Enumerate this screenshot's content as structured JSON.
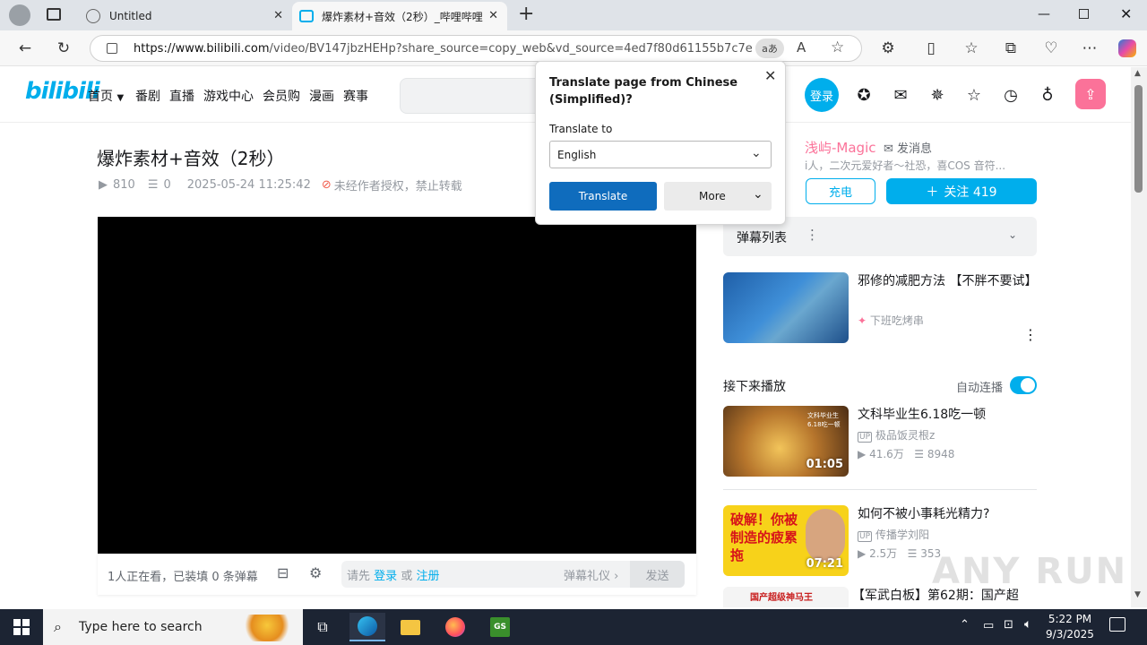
{
  "browser": {
    "tabs": [
      {
        "title": "Untitled",
        "active": false
      },
      {
        "title": "爆炸素材+音效（2秒）_哔哩哔哩",
        "active": true
      }
    ],
    "new_tab_label": "+",
    "url_host": "https://www.bilibili.com",
    "url_path": "/video/BV147jbzHEHp?share_source=copy_web&vd_source=4ed7f80d61155b7c7eee...",
    "read_aloud_label": "aあ"
  },
  "bili_header": {
    "logo": "bilibili",
    "nav": [
      "首页",
      "番剧",
      "直播",
      "游戏中心",
      "会员购",
      "漫画",
      "赛事"
    ],
    "login_label": "登录"
  },
  "video": {
    "title": "爆炸素材+音效（2秒）",
    "views": "810",
    "danmaku_count": "0",
    "date": "2025-05-24 11:25:42",
    "copyright": "未经作者授权，禁止转载",
    "watching": "1人正在看，已装填 0 条弹幕",
    "danmaku_placeholder_prefix": "请先",
    "login_link": "登录",
    "or": "或",
    "register_link": "注册",
    "etiquette": "弹幕礼仪",
    "send_label": "发送"
  },
  "uploader": {
    "name": "浅屿-Magic",
    "message_label": "发消息",
    "bio": "i人，二次元爱好者～社恐，喜COS 音符...",
    "charge_label": "充电",
    "follow_label": "关注 419"
  },
  "danmaku_list": {
    "label": "弹幕列表"
  },
  "ad": {
    "title": "邪修的减肥方法 【不胖不要试】",
    "author": "下班吃烤串"
  },
  "up_next": {
    "label": "接下来播放",
    "autoplay_label": "自动连播",
    "autoplay_on": true
  },
  "recommendations": [
    {
      "title": "文科毕业生6.18吃一顿",
      "author": "极品饭灵根z",
      "views": "41.6万",
      "danmaku": "8948",
      "duration": "01:05",
      "thumb_text": "文科毕业生\n6.18吃一顿"
    },
    {
      "title": "如何不被小事耗光精力?",
      "author": "传播学刘阳",
      "views": "2.5万",
      "danmaku": "353",
      "duration": "07:21",
      "thumb_text": "破解！你被制造的疲累拖"
    },
    {
      "title": "【军武白板】第62期：国产超",
      "thumb_text": "国产超级神马王"
    }
  ],
  "translate_popup": {
    "title": "Translate page from Chinese (Simplified)?",
    "translate_to_label": "Translate to",
    "language": "English",
    "translate_button": "Translate",
    "more_button": "More"
  },
  "taskbar": {
    "search_placeholder": "Type here to search",
    "time": "5:22 PM",
    "date": "9/3/2025"
  },
  "watermark": "ANY RUN",
  "colors": {
    "bili_blue": "#00aeec",
    "bili_pink": "#fb7299",
    "edge_blue": "#0f6cbd"
  }
}
